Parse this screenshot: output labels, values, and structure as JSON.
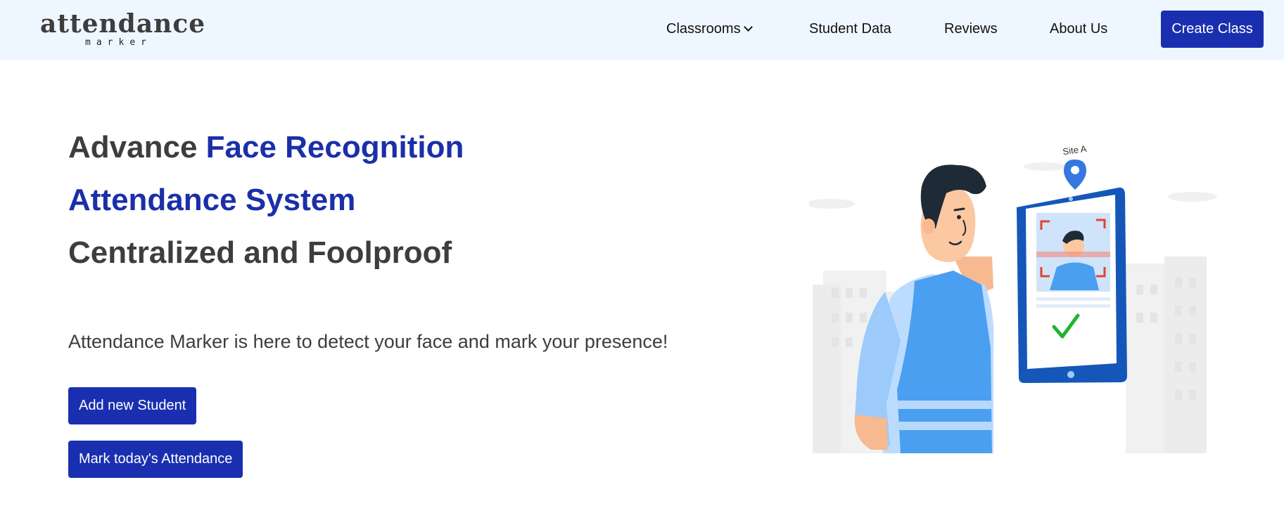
{
  "brand": {
    "name": "attendance",
    "tagline": "marker"
  },
  "nav": {
    "items": [
      {
        "label": "Classrooms",
        "has_dropdown": true
      },
      {
        "label": "Student Data"
      },
      {
        "label": "Reviews"
      },
      {
        "label": "About Us"
      }
    ],
    "cta_label": "Create Class"
  },
  "hero": {
    "line1_prefix": "Advance ",
    "line1_highlight": "Face Recognition",
    "line2": "Attendance System",
    "line3": "Centralized and Foolproof",
    "description": "Attendance Marker is here to detect your face and mark your presence!",
    "primary_button": "Add new Student",
    "secondary_button": "Mark today's Attendance"
  },
  "illustration": {
    "pin_label": "Site A"
  },
  "colors": {
    "accent": "#1a2fb0",
    "nav_bg": "#eef7ff",
    "heading_dark": "#3d3d3d",
    "check": "#1fb52e"
  }
}
